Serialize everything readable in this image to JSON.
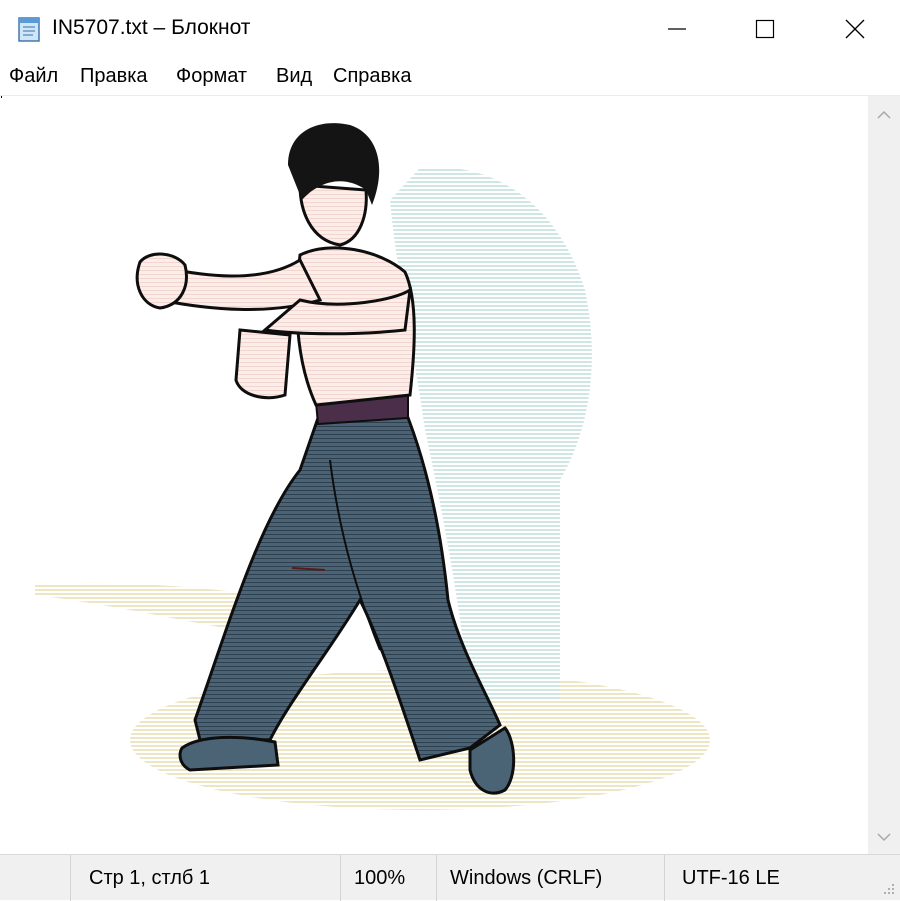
{
  "window": {
    "title": "IN5707.txt – Блокнот",
    "icon": "notepad-icon"
  },
  "controls": {
    "minimize_icon": "minimize-icon",
    "maximize_icon": "maximize-icon",
    "close_icon": "close-icon"
  },
  "menu": {
    "items": [
      "Файл",
      "Правка",
      "Формат",
      "Вид",
      "Справка"
    ]
  },
  "editor": {
    "content": "ASCII-art colored illustration: martial artist in fighting stance",
    "colors": {
      "hair": "#141414",
      "skin": "#f8e4de",
      "pants": "#4a6476",
      "belt": "#4a2e4a",
      "shadow": "#ede6c4",
      "motion_lines": "#cfe6e2"
    }
  },
  "statusbar": {
    "position": "Стр 1, стлб 1",
    "zoom": "100%",
    "line_endings": "Windows (CRLF)",
    "encoding": "UTF-16 LE"
  }
}
